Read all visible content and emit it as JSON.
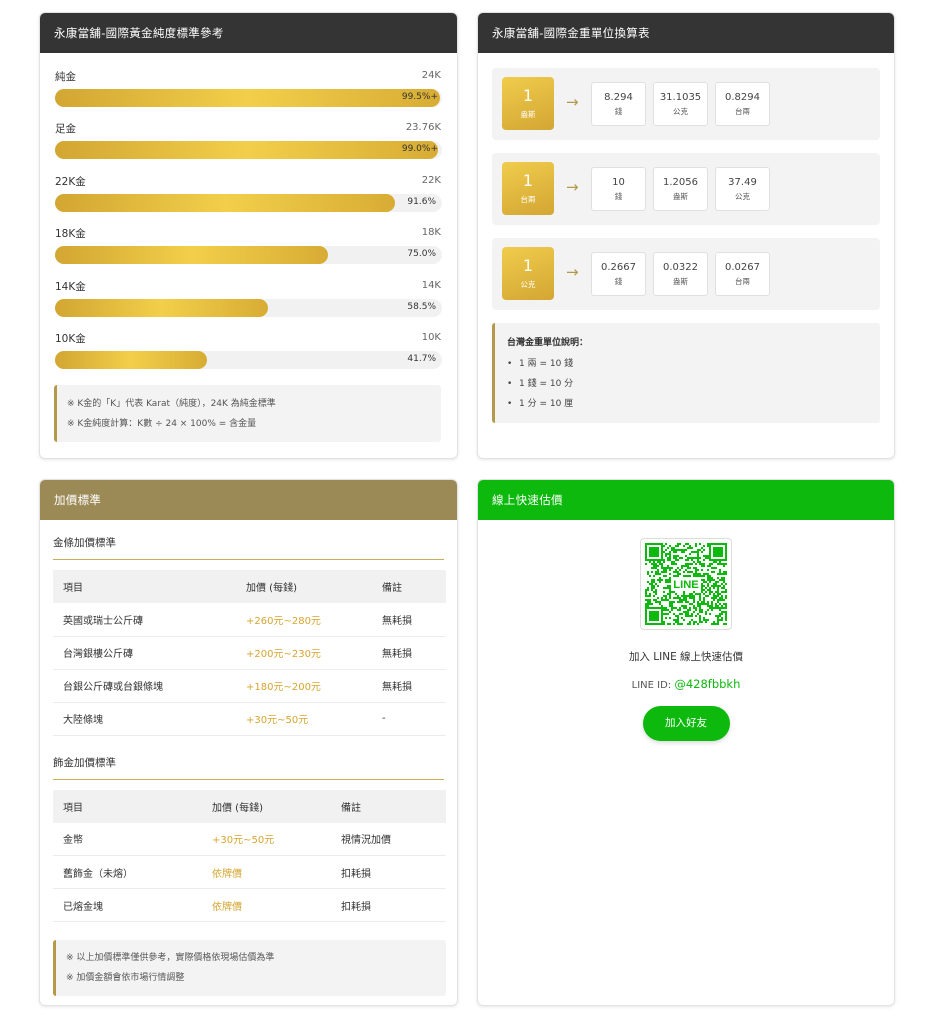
{
  "purity": {
    "title": "永康當舖-國際黃金純度標準參考",
    "rows": [
      {
        "name": "純金",
        "karat": "24K",
        "pct_label": "99.5%+",
        "fill": 99.5
      },
      {
        "name": "足金",
        "karat": "23.76K",
        "pct_label": "99.0%+",
        "fill": 99.0
      },
      {
        "name": "22K金",
        "karat": "22K",
        "pct_label": "91.6%",
        "fill": 91.6
      },
      {
        "name": "18K金",
        "karat": "18K",
        "pct_label": "75.0%",
        "fill": 75.0
      },
      {
        "name": "14K金",
        "karat": "14K",
        "pct_label": "58.5%",
        "fill": 58.5
      },
      {
        "name": "10K金",
        "karat": "10K",
        "pct_label": "41.7%",
        "fill": 41.7
      }
    ],
    "notes": [
      "※ K金的「K」代表 Karat（純度），24K 為純金標準",
      "※ K金純度計算：K數 ÷ 24 × 100% = 含金量"
    ]
  },
  "conversion": {
    "title": "永康當舖-國際金重單位換算表",
    "arrow": "→",
    "rows": [
      {
        "num": "1",
        "unit": "盎斯",
        "items": [
          {
            "v": "8.294",
            "u": "錢"
          },
          {
            "v": "31.1035",
            "u": "公克"
          },
          {
            "v": "0.8294",
            "u": "台兩"
          }
        ]
      },
      {
        "num": "1",
        "unit": "台兩",
        "items": [
          {
            "v": "10",
            "u": "錢"
          },
          {
            "v": "1.2056",
            "u": "盎斯"
          },
          {
            "v": "37.49",
            "u": "公克"
          }
        ]
      },
      {
        "num": "1",
        "unit": "公克",
        "items": [
          {
            "v": "0.2667",
            "u": "錢"
          },
          {
            "v": "0.0322",
            "u": "盎斯"
          },
          {
            "v": "0.0267",
            "u": "台兩"
          }
        ]
      }
    ],
    "tw_title": "台灣金重單位說明：",
    "tw_items": [
      "1 兩 = 10 錢",
      "1 錢 = 10 分",
      "1 分 = 10 厘"
    ]
  },
  "markup": {
    "title": "加價標準",
    "bar": {
      "section": "金條加價標準",
      "headers": [
        "項目",
        "加價 (每錢)",
        "備註"
      ],
      "rows": [
        [
          "英國或瑞士公斤磚",
          "+260元~280元",
          "無耗損"
        ],
        [
          "台灣銀樓公斤磚",
          "+200元~230元",
          "無耗損"
        ],
        [
          "台銀公斤磚或台銀條塊",
          "+180元~200元",
          "無耗損"
        ],
        [
          "大陸條塊",
          "+30元~50元",
          "-"
        ]
      ]
    },
    "jewelry": {
      "section": "飾金加價標準",
      "headers": [
        "項目",
        "加價 (每錢)",
        "備註"
      ],
      "rows": [
        [
          "金幣",
          "+30元~50元",
          "視情況加價"
        ],
        [
          "舊飾金（未熔）",
          "依牌價",
          "扣耗損"
        ],
        [
          "已熔金塊",
          "依牌價",
          "扣耗損"
        ]
      ]
    },
    "notes": [
      "※ 以上加價標準僅供參考，實際價格依現場估價為準",
      "※ 加價金額會依市場行情調整"
    ]
  },
  "line": {
    "title": "線上快速估價",
    "qr_caption": "加入 LINE 線上快速估價",
    "id_label": "LINE ID: ",
    "id_value": "@428fbbkh",
    "add_button": "加入好友",
    "qr_logo_text": "LINE",
    "brand_color": "#0cb90c"
  },
  "colors": {
    "gold": "#d6a52f",
    "gold_header": "#9b8a56",
    "dark_header": "#343434",
    "line_green": "#0cb90c"
  }
}
